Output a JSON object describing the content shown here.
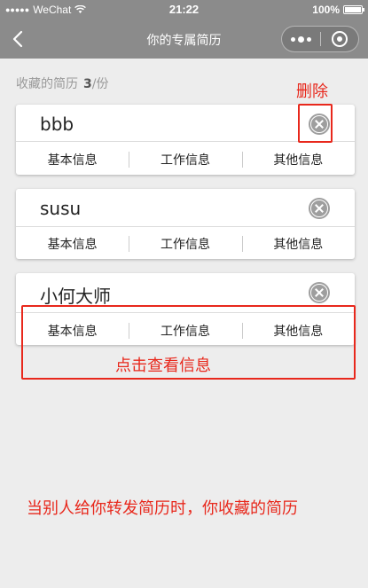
{
  "status_bar": {
    "carrier": "WeChat",
    "time": "21:22",
    "battery": "100%"
  },
  "nav": {
    "title": "你的专属简历"
  },
  "summary": {
    "label": "收藏的简历",
    "count": "3",
    "unit": "/份"
  },
  "tab_labels": [
    "基本信息",
    "工作信息",
    "其他信息"
  ],
  "cards": [
    {
      "name": "bbb",
      "tabs": [
        "基本信息",
        "工作信息",
        "其他信息"
      ]
    },
    {
      "name": "susu",
      "tabs": [
        "基本信息",
        "工作信息",
        "其他信息"
      ]
    },
    {
      "name": "小何大师",
      "tabs": [
        "基本信息",
        "工作信息",
        "其他信息"
      ]
    }
  ],
  "annotations": {
    "delete": "删除",
    "view_info": "点击查看信息",
    "note": "当别人给你转发简历时，你收藏的简历"
  },
  "colors": {
    "annotation": "#e8281c",
    "nav_bg": "#8b8b8b",
    "page_bg": "#ededed"
  }
}
